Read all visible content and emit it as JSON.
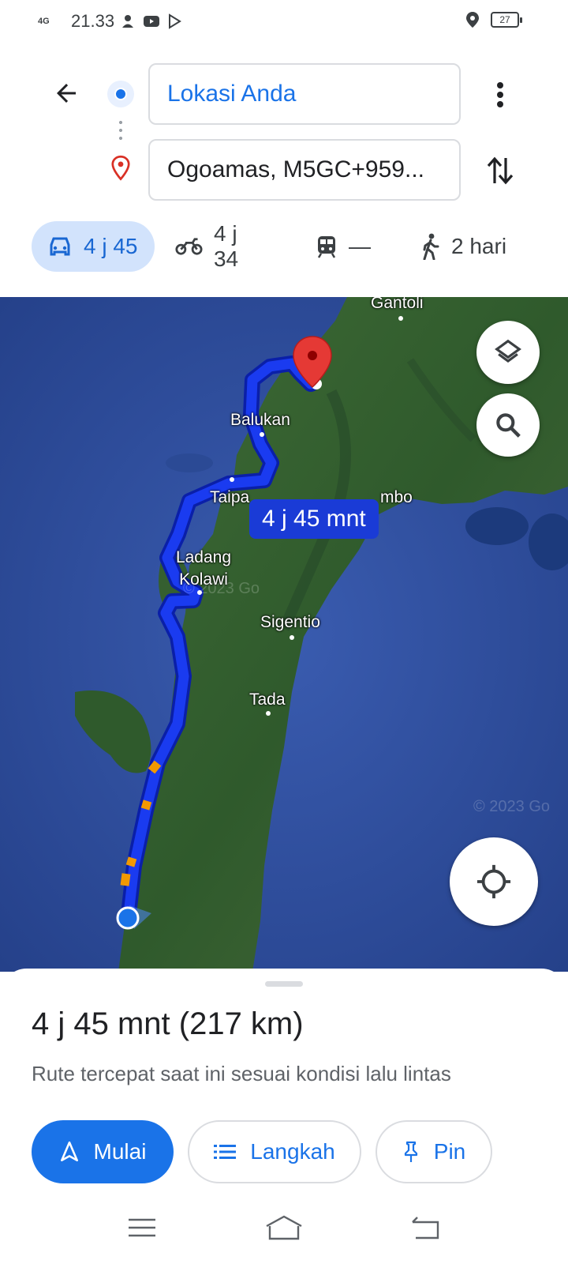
{
  "status_bar": {
    "network": "4G",
    "time": "21.33",
    "battery": "27",
    "icons": [
      "person-add-icon",
      "youtube-icon",
      "play-store-icon",
      "location-icon",
      "battery-icon"
    ]
  },
  "directions": {
    "origin": "Lokasi Anda",
    "destination": "Ogoamas, M5GC+959..."
  },
  "modes": [
    {
      "name": "car",
      "icon": "car-icon",
      "label": "4 j 45",
      "active": true
    },
    {
      "name": "motorcycle",
      "icon": "motorcycle-icon",
      "label": "4 j 34",
      "active": false
    },
    {
      "name": "transit",
      "icon": "train-icon",
      "label": "—",
      "active": false
    },
    {
      "name": "walking",
      "icon": "walking-icon",
      "label": "2 hari",
      "active": false
    }
  ],
  "map": {
    "places": [
      "Gantoli",
      "Balukan",
      "Taipa",
      "mbo",
      "Ladang Kolawi",
      "Sigentio",
      "Tada"
    ],
    "route_label": "4 j 45 mnt",
    "watermarks": [
      "© 2023 Go",
      "© 2023 Go"
    ],
    "route_color": "#1a3bf0",
    "traffic_color": "#f29900"
  },
  "sheet": {
    "summary": "4 j 45 mnt (217 km)",
    "subtext": "Rute tercepat saat ini sesuai kondisi lalu lintas",
    "start_label": "Mulai",
    "steps_label": "Langkah",
    "pin_label": "Pin"
  },
  "colors": {
    "accent": "#1a73e8",
    "active_chip": "#d2e3fc",
    "destination_pin": "#d93025"
  }
}
